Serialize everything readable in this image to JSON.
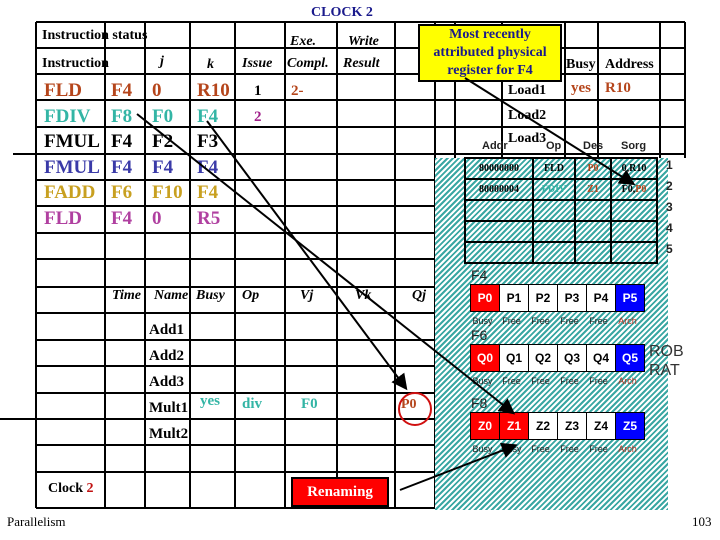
{
  "title": "CLOCK 2",
  "instruction_status": {
    "label": "Instruction status",
    "headers": {
      "instruction": "Instruction",
      "j": "j",
      "k": "k",
      "issue": "Issue",
      "exe_top": "Exe.",
      "exe_bottom": "Compl.",
      "write_top": "Write",
      "write_bottom": "Result"
    },
    "rows": [
      {
        "op": "FLD",
        "dest": "F4",
        "j": "0",
        "k": "R10",
        "issue": "1",
        "exe": "2-",
        "write": "",
        "color": "#b5451b"
      },
      {
        "op": "FDIV",
        "dest": "F8",
        "j": "F0",
        "k": "F4",
        "issue": "2",
        "exe": "",
        "write": "",
        "color": "#33b5a5"
      },
      {
        "op": "FMUL",
        "dest": "F4",
        "j": "F2",
        "k": "F3",
        "issue": "",
        "exe": "",
        "write": "",
        "color": "#000000"
      },
      {
        "op": "FMUL",
        "dest": "F4",
        "j": "F4",
        "k": "F4",
        "issue": "",
        "exe": "",
        "write": "",
        "color": "#3a3aa8"
      },
      {
        "op": "FADD",
        "dest": "F6",
        "j": "F10",
        "k": "F4",
        "issue": "",
        "exe": "",
        "write": "",
        "color": "#c8a020"
      },
      {
        "op": "FLD",
        "dest": "F4",
        "j": "0",
        "k": "R5",
        "issue": "",
        "exe": "",
        "write": "",
        "color": "#b040a0"
      }
    ]
  },
  "callout": "Most recently attributed physical register for F4",
  "load_buffers": {
    "headers": {
      "busy": "Busy",
      "address": "Address"
    },
    "rows": [
      {
        "name": "Load1",
        "busy": "yes",
        "address": "R10"
      },
      {
        "name": "Load2",
        "busy": "",
        "address": ""
      },
      {
        "name": "Load3",
        "busy": "",
        "address": ""
      }
    ]
  },
  "rob": {
    "headers": {
      "addr": "Addr",
      "op": "Op",
      "des": "Des",
      "sorg": "Sorg"
    },
    "rows": [
      {
        "num": "1",
        "addr": "80000000",
        "op": "FLD",
        "des": "P0",
        "sorg": "0,R10",
        "sorg_tag": ""
      },
      {
        "num": "2",
        "addr": "80000004",
        "op": "FDIV",
        "des": "Z1",
        "sorg": "F0,",
        "sorg_tag": "P0"
      },
      {
        "num": "3",
        "addr": "",
        "op": "",
        "des": "",
        "sorg": "",
        "sorg_tag": ""
      },
      {
        "num": "4",
        "addr": "",
        "op": "",
        "des": "",
        "sorg": "",
        "sorg_tag": ""
      },
      {
        "num": "5",
        "addr": "",
        "op": "",
        "des": "",
        "sorg": "",
        "sorg_tag": ""
      }
    ]
  },
  "register_files": [
    {
      "label": "F4",
      "regs": [
        "P0",
        "P1",
        "P2",
        "P3",
        "P4",
        "P5"
      ],
      "states": [
        "Busy",
        "Free",
        "Free",
        "Free",
        "Free",
        "Arch"
      ]
    },
    {
      "label": "F6",
      "regs": [
        "Q0",
        "Q1",
        "Q2",
        "Q3",
        "Q4",
        "Q5"
      ],
      "states": [
        "Busy",
        "Free",
        "Free",
        "Free",
        "Free",
        "Arch"
      ]
    },
    {
      "label": "F8",
      "regs": [
        "Z0",
        "Z1",
        "Z2",
        "Z3",
        "Z4",
        "Z5"
      ],
      "states": [
        "Busy",
        "Busy",
        "Free",
        "Free",
        "Free",
        "Arch"
      ]
    }
  ],
  "rob_rat_label": {
    "line1": "ROB",
    "line2": "RAT"
  },
  "reservation_stations": {
    "headers": {
      "time": "Time",
      "name": "Name",
      "busy": "Busy",
      "op": "Op",
      "vj": "Vj",
      "vk": "Vk",
      "qj": "Qj"
    },
    "rows": [
      {
        "name": "Add1",
        "busy": "",
        "op": "",
        "vj": "",
        "qj": ""
      },
      {
        "name": "Add2",
        "busy": "",
        "op": "",
        "vj": "",
        "qj": ""
      },
      {
        "name": "Add3",
        "busy": "",
        "op": "",
        "vj": "",
        "qj": ""
      },
      {
        "name": "Mult1",
        "busy": "yes",
        "op": "div",
        "vj": "F0",
        "qj": "P0"
      },
      {
        "name": "Mult2",
        "busy": "",
        "op": "",
        "vj": "",
        "qj": ""
      }
    ]
  },
  "clock": {
    "label": "Clock",
    "value": "2"
  },
  "renaming_button": "Renaming",
  "footer": {
    "left": "Parallelism",
    "page": "103"
  },
  "colors": {
    "busy": "#ff0000",
    "arch": "#0000ff",
    "hatch": "#3aa7a3",
    "callout": "#ffff00",
    "title": "#1a1a8c",
    "accent": "#b5451b",
    "fdiv": "#33b5a5"
  }
}
